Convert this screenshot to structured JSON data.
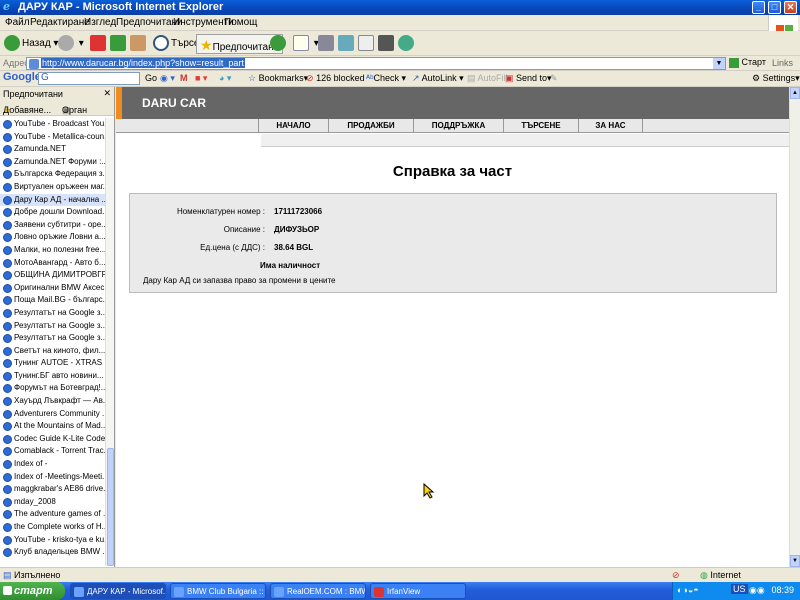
{
  "window": {
    "title": "ДАРУ КАР - Microsoft Internet Explorer"
  },
  "menu": [
    "Файл",
    "Редактиране",
    "Изглед",
    "Предпочитани",
    "Инструменти",
    "Помощ"
  ],
  "toolbar": {
    "back": "Назад",
    "search": "Търсен",
    "favorites": "Предпочитани"
  },
  "address": {
    "label": "Адрес",
    "url": "http://www.darucar.bg/index.php?show=result_part",
    "go": "Старт",
    "links": "Links"
  },
  "google_bar": {
    "logo": "Google",
    "go": "Go",
    "bookmarks": "Bookmarks▾",
    "blocked": "126 blocked",
    "check": "Check",
    "autolink": "AutoLink",
    "autofill": "AutoFill",
    "sendto": "Send to▾",
    "settings": "Settings▾"
  },
  "sidebar": {
    "title": "Предпочитани",
    "add": "Добавяне...",
    "organize": "Орган",
    "items": [
      "YouTube - Broadcast You...",
      "YouTube - Metallica-coun...",
      "Zamunda.NET",
      "Zamunda.NET Форуми :...",
      "Българска Федерация з...",
      "Виртуален оръжеен маг...",
      "Дару Кар АД - начална ...",
      "Добре дошли   Download...",
      "Заявени субтитри - ope...",
      "Ловно оръжие   Ловни а...",
      "Малки, но полезни free...",
      "МотоАвангард - Авто б...",
      "ОБЩИНА ДИМИТРОВГРАД",
      "Оригинални BMW Аксес...",
      "Поща  Mail.BG - българс...",
      "Резултатът на Google з...",
      "Резултатът на Google з...",
      "Резултатът на Google з...",
      "Светът на киното, фил...",
      "Тунинг AUTOE - XTRAS ...",
      "Тунинг.БГ  авто новини...",
      "Форумът на Ботевград!...",
      "Хауърд Лъвкрафт — Ав...",
      "Adventurers Community ...",
      "At the Mountains of Mad...",
      "Codec Guide K-Lite Code...",
      "Comablack - Torrent Trac...",
      "Index of -",
      "Index of -Meetings-Meeti...",
      "maggkrabar's AE86 drive...",
      "mday_2008",
      "The adventure games of ...",
      "the Complete works of H...",
      "YouTube - krisko-tya e ku...",
      "Клуб владельцев BMW ..."
    ],
    "selected_index": 6
  },
  "site": {
    "logo": "DARU CAR",
    "nav": [
      "НАЧАЛО",
      "ПРОДАЖБИ",
      "ПОДДРЪЖКА",
      "ТЪРСЕНЕ",
      "ЗА НАС"
    ],
    "accent_color": "#F08C1C",
    "page_title": "Справка за част",
    "fields": [
      {
        "label": "Номенклатурен номер :",
        "value": "17111723066"
      },
      {
        "label": "Описание :",
        "value": "ДИФУЗЬОР"
      },
      {
        "label": "Ед.цена (с ДДС) :",
        "value": "38.64 BGL"
      }
    ],
    "availability": "Има наличност",
    "note": "Дару Кар АД си запазва право за промени в цените"
  },
  "status": {
    "text": "Изпълнено",
    "zone": "Internet"
  },
  "taskbar": {
    "start": "старт",
    "tasks": [
      {
        "label": "ДАРУ КАР - Microsof...",
        "active": true
      },
      {
        "label": "BMW Club Bulgaria :: ...",
        "active": false
      },
      {
        "label": "RealOEM.COM : BMW...",
        "active": false
      },
      {
        "label": "IrfanView",
        "active": false
      }
    ],
    "lang": "US",
    "clock": "08:39"
  }
}
